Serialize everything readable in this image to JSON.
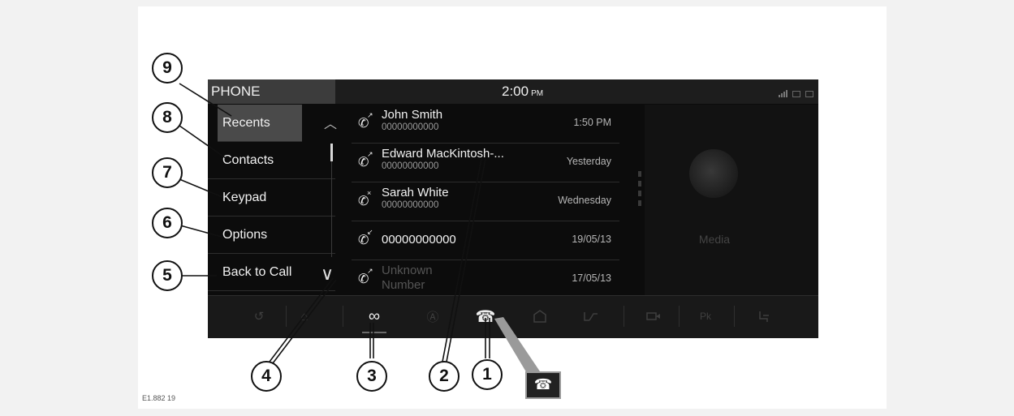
{
  "figure_code": "E1.882 19",
  "header": {
    "app_title": "PHONE",
    "clock_time": "2:00",
    "clock_ampm": "PM"
  },
  "menu": {
    "items": [
      {
        "label": "Recents",
        "active": true
      },
      {
        "label": "Contacts"
      },
      {
        "label": "Keypad"
      },
      {
        "label": "Options"
      },
      {
        "label": "Back to Call"
      }
    ]
  },
  "calls": [
    {
      "name": "John Smith",
      "number": "00000000000",
      "time": "1:50 PM",
      "type": "outgoing"
    },
    {
      "name": "Edward MacKintosh-...",
      "number": "00000000000",
      "time": "Yesterday",
      "type": "outgoing"
    },
    {
      "name": "Sarah White",
      "number": "00000000000",
      "time": "Wednesday",
      "type": "missed"
    },
    {
      "name": "00000000000",
      "number": "",
      "time": "19/05/13",
      "type": "incoming"
    },
    {
      "name": "Unknown",
      "number": "Number",
      "time": "17/05/13",
      "type": "outgoing"
    }
  ],
  "media": {
    "label": "Media"
  },
  "navbar": {
    "icons": [
      "back-icon",
      "home-icon",
      "link-icon",
      "navigation-icon",
      "phone-icon",
      "vehicle-icon",
      "climate-icon",
      "camera-icon",
      "parking-icon",
      "seat-icon"
    ],
    "parking_label": "Pk"
  },
  "callouts": [
    "1",
    "2",
    "3",
    "4",
    "5",
    "6",
    "7",
    "8",
    "9"
  ],
  "icon_glyphs": {
    "phone": "☎",
    "end_call": "☎",
    "handset": "✆",
    "chevron_up": "︿",
    "chevron_down": "∨",
    "back": "↺",
    "home": "⌂",
    "link": "∞",
    "navigation": "Ⓐ"
  }
}
